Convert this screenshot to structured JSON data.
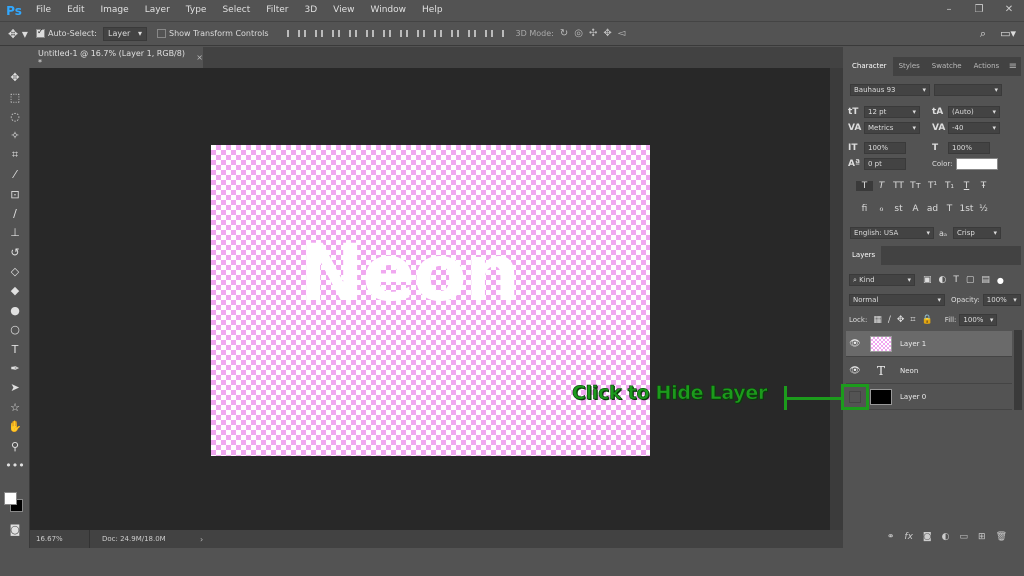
{
  "app": {
    "logo": "Ps"
  },
  "menu": [
    "File",
    "Edit",
    "Image",
    "Layer",
    "Type",
    "Select",
    "Filter",
    "3D",
    "View",
    "Window",
    "Help"
  ],
  "window_controls": [
    "–",
    "❐",
    "✕"
  ],
  "options": {
    "auto_select_label": "Auto-Select:",
    "auto_select_value": "Layer",
    "show_transform_label": "Show Transform Controls",
    "mode3d_label": "3D Mode:"
  },
  "document": {
    "tab_title": "Untitled-1 @ 16.7% (Layer 1, RGB/8) *",
    "close": "×",
    "canvas_text": "Neon"
  },
  "status": {
    "zoom": "16.67%",
    "doc": "Doc: 24.9M/18.0M",
    "arrow": "›"
  },
  "character_panel": {
    "tabs": [
      "Character",
      "Styles",
      "Swatche",
      "Actions"
    ],
    "font_family": "Bauhaus 93",
    "font_style": "",
    "font_size": "12 pt",
    "leading": "(Auto)",
    "kerning": "Metrics",
    "tracking": "-40",
    "vertical_scale": "100%",
    "horizontal_scale": "100%",
    "baseline_shift": "0 pt",
    "color_label": "Color:",
    "language": "English: USA",
    "aa_label": "aₐ",
    "antialias": "Crisp",
    "style_buttons": [
      "T",
      "T",
      "TT",
      "Tт",
      "T¹",
      "T₁",
      "T",
      "Ŧ"
    ],
    "opentype_buttons": [
      "fi",
      "ℴ",
      "st",
      "A",
      "ad",
      "T",
      "1st",
      "½"
    ]
  },
  "layers_panel": {
    "tab": "Layers",
    "filter_kind": "Kind",
    "blend_mode": "Normal",
    "opacity_label": "Opacity:",
    "opacity": "100%",
    "lock_label": "Lock:",
    "fill_label": "Fill:",
    "fill": "100%",
    "layers": [
      {
        "name": "Layer 1",
        "type": "checker",
        "visible": true,
        "selected": true
      },
      {
        "name": "Neon",
        "type": "text",
        "visible": true,
        "selected": false
      },
      {
        "name": "Layer 0",
        "type": "black",
        "visible": false,
        "selected": false
      }
    ],
    "footer_icons": [
      "link-icon",
      "fx-icon",
      "mask-icon",
      "adjustment-icon",
      "group-icon",
      "new-layer-icon",
      "trash-icon"
    ]
  },
  "annotation": {
    "text": "Click to Hide Layer",
    "color": "#1c9b1c"
  }
}
